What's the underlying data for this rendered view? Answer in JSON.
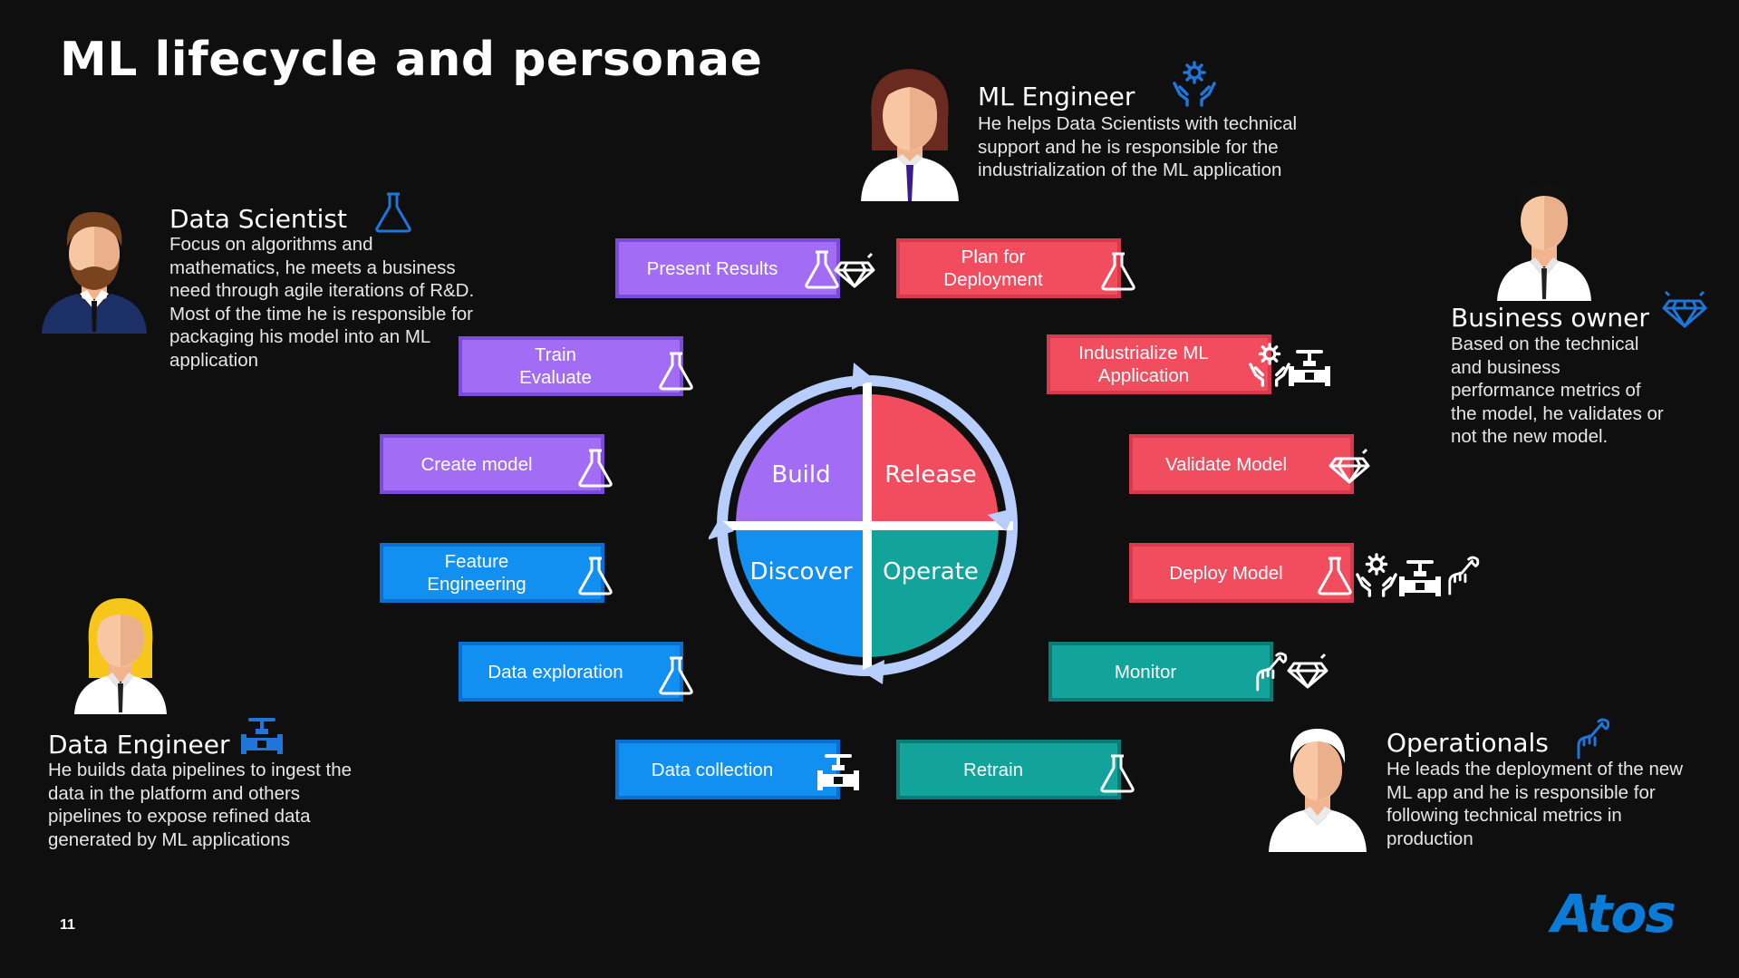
{
  "title": "ML lifecycle and personae",
  "page_number": "11",
  "logo": "Atos",
  "colors": {
    "build": "#a36cf5",
    "release": "#f24d5f",
    "discover": "#1190f2",
    "operate": "#12a39a",
    "ring": "#b7cdfb",
    "icon_blue": "#1f76d8",
    "background": "#0f0f10"
  },
  "personas": {
    "ml_engineer": {
      "name": "ML Engineer",
      "description": [
        "He helps Data Scientists with technical",
        "support and he is responsible for the",
        "industrialization of the ML application"
      ],
      "icon": "hands-gear-icon"
    },
    "data_scientist": {
      "name": "Data Scientist",
      "description": [
        "Focus on algorithms and",
        "mathematics, he meets a business",
        "need through agile iterations of R&D.",
        "Most of the time he is responsible for",
        "packaging his model into an ML",
        "application"
      ],
      "icon": "flask-icon"
    },
    "business_owner": {
      "name": "Business owner",
      "description": [
        "Based on the technical",
        "and business",
        "performance metrics of",
        "the model, he validates or",
        "not the new model."
      ],
      "icon": "diamond-icon"
    },
    "data_engineer": {
      "name": "Data Engineer",
      "description": [
        "He builds data pipelines to ingest the",
        "data in the platform and others",
        "pipelines to expose refined data",
        "generated by ML applications"
      ],
      "icon": "valve-pipe-icon"
    },
    "operationals": {
      "name": "Operationals",
      "description": [
        "He leads the deployment of the new",
        "ML app and he is responsible for",
        "following technical metrics in",
        "production"
      ],
      "icon": "hand-wrench-icon"
    }
  },
  "cycle": {
    "quadrants": [
      "Build",
      "Release",
      "Discover",
      "Operate"
    ]
  },
  "steps": {
    "present_results": {
      "label": "Present Results",
      "phase": "build",
      "icons": [
        "flask-icon",
        "diamond-icon"
      ]
    },
    "train_evaluate": {
      "label": [
        "Train",
        "Evaluate"
      ],
      "phase": "build",
      "icons": [
        "flask-icon"
      ]
    },
    "create_model": {
      "label": "Create model",
      "phase": "build",
      "icons": [
        "flask-icon"
      ]
    },
    "feature_engineering": {
      "label": [
        "Feature",
        "Engineering"
      ],
      "phase": "discover",
      "icons": [
        "flask-icon"
      ]
    },
    "data_exploration": {
      "label": "Data exploration",
      "phase": "discover",
      "icons": [
        "flask-icon"
      ]
    },
    "data_collection": {
      "label": "Data collection",
      "phase": "discover",
      "icons": [
        "valve-pipe-icon"
      ]
    },
    "plan_deployment": {
      "label": [
        "Plan for",
        "Deployment"
      ],
      "phase": "release",
      "icons": [
        "flask-icon"
      ]
    },
    "industrialize": {
      "label": [
        "Industrialize ML",
        "Application"
      ],
      "phase": "release",
      "icons": [
        "hands-gear-icon",
        "valve-pipe-icon"
      ]
    },
    "validate_model": {
      "label": "Validate Model",
      "phase": "release",
      "icons": [
        "diamond-icon"
      ]
    },
    "deploy_model": {
      "label": "Deploy Model",
      "phase": "release",
      "icons": [
        "flask-icon",
        "hands-gear-icon",
        "valve-pipe-icon",
        "hand-wrench-icon"
      ]
    },
    "monitor": {
      "label": "Monitor",
      "phase": "operate",
      "icons": [
        "hand-wrench-icon",
        "diamond-icon"
      ]
    },
    "retrain": {
      "label": "Retrain",
      "phase": "operate",
      "icons": [
        "flask-icon"
      ]
    }
  }
}
